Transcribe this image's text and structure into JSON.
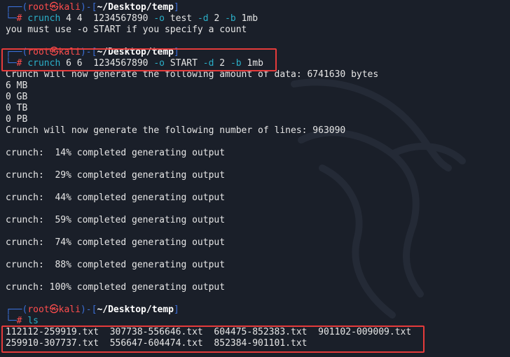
{
  "prompt": {
    "open": "┌──(",
    "user": "root",
    "skull": "㉿",
    "host": "kali",
    "mid": ")-[",
    "path": "~/Desktop/temp",
    "close": "]",
    "arrow": "└─",
    "hash": "#"
  },
  "cmd1": {
    "name": "crunch",
    "args1": " 4 4  1234567890 ",
    "opt_o": "-o",
    "args2": " test ",
    "opt_d": "-d",
    "args3": " 2 ",
    "opt_b": "-b",
    "args4": " 1mb"
  },
  "error_line": "you must use -o START if you specify a count",
  "cmd2": {
    "name": "crunch",
    "args1": " 6 6  1234567890 ",
    "opt_o": "-o",
    "args2": " START ",
    "opt_d": "-d",
    "args3": " 2 ",
    "opt_b": "-b",
    "args4": " 1mb"
  },
  "output": {
    "data_amount": "Crunch will now generate the following amount of data: 6741630 bytes",
    "mb": "6 MB",
    "gb": "0 GB",
    "tb": "0 TB",
    "pb": "0 PB",
    "lines": "Crunch will now generate the following number of lines: 963090",
    "p14": "crunch:  14% completed generating output",
    "p29": "crunch:  29% completed generating output",
    "p44": "crunch:  44% completed generating output",
    "p59": "crunch:  59% completed generating output",
    "p74": "crunch:  74% completed generating output",
    "p88": "crunch:  88% completed generating output",
    "p100": "crunch: 100% completed generating output"
  },
  "cmd3": {
    "name": "ls"
  },
  "ls_rows": [
    "112112-259919.txt  307738-556646.txt  604475-852383.txt  901102-009009.txt",
    "259910-307737.txt  556647-604474.txt  852384-901101.txt"
  ],
  "colors": {
    "background": "#1a1f29",
    "prompt_blue": "#3b6fd8",
    "prompt_red": "#ff4d4d",
    "command_cyan": "#2bb0c9",
    "highlight_box": "#e53b3b"
  }
}
